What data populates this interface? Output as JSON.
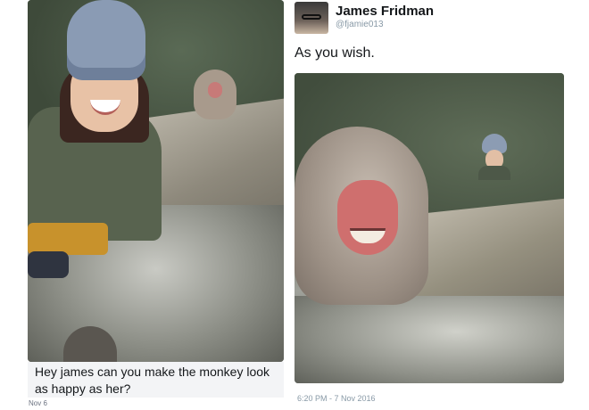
{
  "request": {
    "caption": "Hey james can you make the monkey look as happy as her?",
    "date": "Nov 6"
  },
  "tweet": {
    "author_name": "James Fridman",
    "author_handle": "@fjamie013",
    "text": "As you wish.",
    "timestamp": "6:20 PM - 7 Nov 2016"
  }
}
